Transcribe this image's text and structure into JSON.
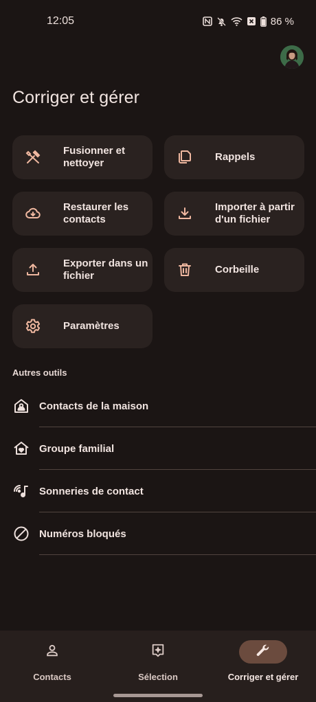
{
  "status_bar": {
    "time": "12:05",
    "battery": "86 %",
    "icons": [
      "nfc-icon",
      "mute-icon",
      "wifi-icon",
      "data-saver-icon",
      "battery-icon"
    ]
  },
  "header": {
    "title": "Corriger et gérer",
    "avatar": "account-avatar"
  },
  "cards": [
    {
      "label": "Fusionner et\nnettoyer",
      "icon": "merge-tools-icon"
    },
    {
      "label": "Rappels",
      "icon": "copy-icon"
    },
    {
      "label": "Restaurer les\ncontacts",
      "icon": "cloud-download-icon"
    },
    {
      "label": "Importer à partir\nd'un fichier",
      "icon": "download-icon"
    },
    {
      "label": "Exporter dans un\nfichier",
      "icon": "upload-icon"
    },
    {
      "label": "Corbeille",
      "icon": "trash-icon"
    },
    {
      "label": "Paramètres",
      "icon": "gear-icon"
    }
  ],
  "other_tools": {
    "header": "Autres outils",
    "items": [
      {
        "label": "Contacts de la maison",
        "icon": "home-contact-icon"
      },
      {
        "label": "Groupe familial",
        "icon": "family-home-icon"
      },
      {
        "label": "Sonneries de contact",
        "icon": "ringtone-icon"
      },
      {
        "label": "Numéros bloqués",
        "icon": "block-icon"
      }
    ]
  },
  "bottom_nav": {
    "items": [
      {
        "label": "Contacts",
        "icon": "person-icon",
        "active": false
      },
      {
        "label": "Sélection",
        "icon": "highlights-icon",
        "active": false
      },
      {
        "label": "Corriger et gérer",
        "icon": "wrench-icon",
        "active": true
      }
    ]
  },
  "colors": {
    "background": "#1b1514",
    "card": "#2a2220",
    "accent": "#f0b8a0",
    "active_pill": "#6b4b3e"
  }
}
